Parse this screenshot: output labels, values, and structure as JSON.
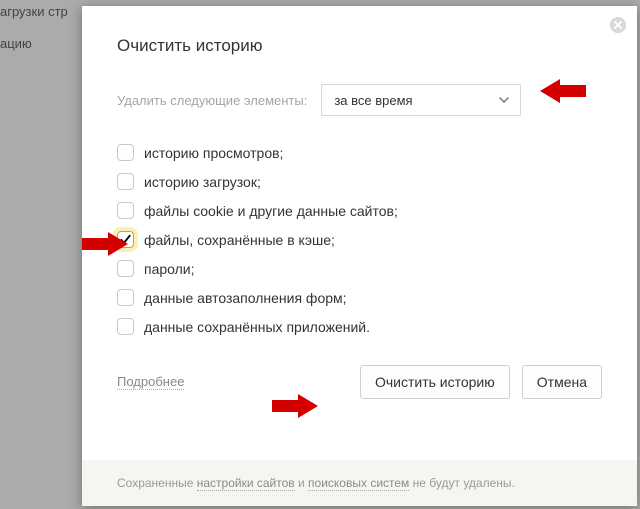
{
  "bg": {
    "line1": "агрузки стр",
    "line2": "ацию"
  },
  "dialog": {
    "title": "Очистить историю",
    "range_label": "Удалить следующие элементы:",
    "range_value": "за все время",
    "items": [
      {
        "label": "историю просмотров;",
        "checked": false
      },
      {
        "label": "историю загрузок;",
        "checked": false
      },
      {
        "label": "файлы cookie и другие данные сайтов;",
        "checked": false
      },
      {
        "label": "файлы, сохранённые в кэше;",
        "checked": true
      },
      {
        "label": "пароли;",
        "checked": false
      },
      {
        "label": "данные автозаполнения форм;",
        "checked": false
      },
      {
        "label": "данные сохранённых приложений.",
        "checked": false
      }
    ],
    "more": "Подробнее",
    "clear": "Очистить историю",
    "cancel": "Отмена",
    "note_pre": "Сохраненные ",
    "note_link1": "настройки сайтов",
    "note_mid": " и ",
    "note_link2": "поисковых систем",
    "note_post": " не будут удалены."
  }
}
